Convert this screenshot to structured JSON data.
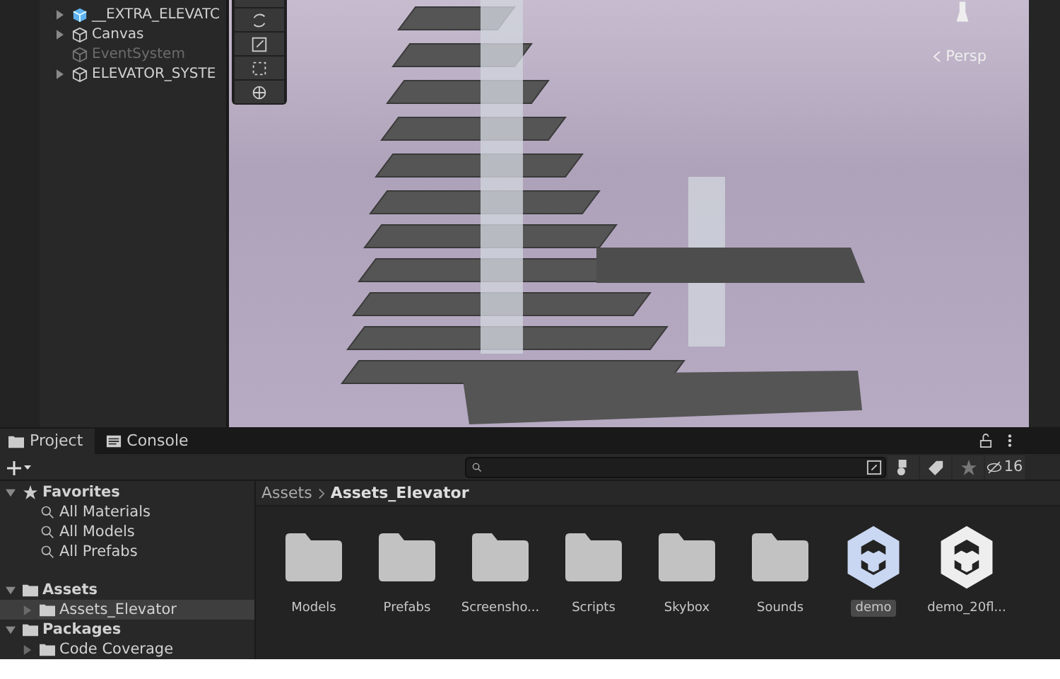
{
  "hierarchy": {
    "items": [
      {
        "label": "__EXTRA_ELEVATC",
        "kind": "prefab",
        "has_children": true,
        "disabled": false
      },
      {
        "label": "Canvas",
        "kind": "object",
        "has_children": true,
        "disabled": false
      },
      {
        "label": "EventSystem",
        "kind": "object",
        "has_children": false,
        "disabled": true
      },
      {
        "label": "ELEVATOR_SYSTE",
        "kind": "object",
        "has_children": true,
        "disabled": false
      }
    ]
  },
  "scene": {
    "view_label": "Persp"
  },
  "project": {
    "tabs": [
      {
        "label": "Project",
        "kind": "folder",
        "selected": true
      },
      {
        "label": "Console",
        "kind": "console",
        "selected": false
      }
    ],
    "hidden_count": "16",
    "favorites": {
      "label": "Favorites",
      "expanded": true,
      "items": [
        "All Materials",
        "All Models",
        "All Prefabs"
      ]
    },
    "tree": [
      {
        "label": "Assets",
        "expanded": true,
        "selected": false,
        "children": [
          {
            "label": "Assets_Elevator",
            "expanded": false,
            "selected": true
          }
        ]
      },
      {
        "label": "Packages",
        "expanded": true,
        "selected": false,
        "children": [
          {
            "label": "Code Coverage",
            "expanded": false,
            "selected": false
          }
        ]
      }
    ],
    "breadcrumb": [
      "Assets",
      "Assets_Elevator"
    ],
    "items": [
      {
        "label": "Models",
        "kind": "folder",
        "selected": false
      },
      {
        "label": "Prefabs",
        "kind": "folder",
        "selected": false
      },
      {
        "label": "Screensho...",
        "kind": "folder",
        "selected": false
      },
      {
        "label": "Scripts",
        "kind": "folder",
        "selected": false
      },
      {
        "label": "Skybox",
        "kind": "folder",
        "selected": false
      },
      {
        "label": "Sounds",
        "kind": "folder",
        "selected": false
      },
      {
        "label": "demo",
        "kind": "scene",
        "selected": true
      },
      {
        "label": "demo_20fl...",
        "kind": "scene",
        "selected": false
      }
    ]
  }
}
